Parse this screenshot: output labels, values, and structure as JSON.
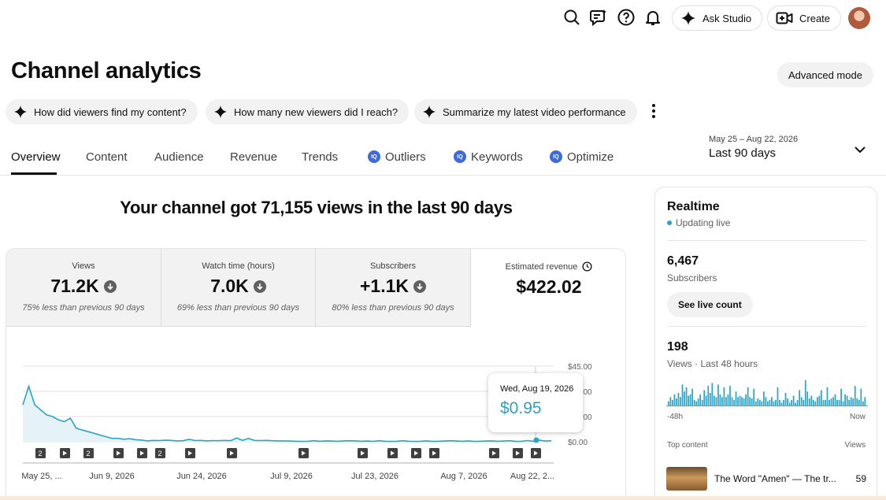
{
  "topbar": {
    "ask_studio_label": "Ask Studio",
    "create_label": "Create",
    "icons": [
      "search-icon",
      "feedback-icon",
      "help-icon",
      "notifications-icon"
    ]
  },
  "page": {
    "title": "Channel analytics",
    "advanced_mode_label": "Advanced mode"
  },
  "chips": [
    {
      "label": "How did viewers find my content?"
    },
    {
      "label": "How many new viewers did I reach?"
    },
    {
      "label": "Summarize my latest video performance"
    }
  ],
  "tabs": [
    {
      "label": "Overview",
      "active": true
    },
    {
      "label": "Content"
    },
    {
      "label": "Audience"
    },
    {
      "label": "Revenue"
    },
    {
      "label": "Trends"
    },
    {
      "label": "Outliers",
      "badge": "IQ"
    },
    {
      "label": "Keywords",
      "badge": "IQ"
    },
    {
      "label": "Optimize",
      "badge": "IQ"
    }
  ],
  "date_range": {
    "dates": "May 25 – Aug 22, 2026",
    "label": "Last 90 days"
  },
  "headline": "Your channel got 71,155 views in the last 90 days",
  "metrics": [
    {
      "label": "Views",
      "value": "71.2K",
      "note": "75% less than previous 90 days",
      "trend": "down"
    },
    {
      "label": "Watch time (hours)",
      "value": "7.0K",
      "note": "69% less than previous 90 days",
      "trend": "down"
    },
    {
      "label": "Subscribers",
      "value": "+1.1K",
      "note": "80% less than previous 90 days",
      "trend": "down"
    },
    {
      "label": "Estimated revenue",
      "value": "$422.02",
      "note": "",
      "trend": "none"
    }
  ],
  "chart_data": {
    "type": "area",
    "title": "",
    "series": [
      {
        "values": [
          22,
          33,
          22,
          19,
          16,
          15,
          13,
          12,
          14,
          8,
          7,
          6,
          5,
          4,
          3,
          2,
          2,
          1.5,
          1.8,
          1.2,
          1,
          0.5,
          0.8,
          0.7,
          0.9,
          0.8,
          0.5,
          0.6,
          1.4,
          0.7,
          0.8,
          0.5,
          0.7,
          0.6,
          0.8,
          0.6,
          2.2,
          0.8,
          1.9,
          0.8,
          0.7,
          0.8,
          0.6,
          0.5,
          0.5,
          0.4,
          0.3,
          0.2,
          0.3,
          0.6,
          0.3,
          0.5,
          0.4,
          0.3,
          0.5,
          0.6,
          0.5,
          0.3,
          0.4,
          0.2,
          0.6,
          0.3,
          0.2,
          0.3,
          0.6,
          0.3,
          0.2,
          0.3,
          0.5,
          0.2,
          0.3,
          0.4,
          0.6,
          0.4,
          0.3,
          0.5,
          0.2,
          0.3,
          0.4,
          0.5,
          0.3,
          0.4,
          0.6,
          0.2,
          0.3,
          0.7,
          0.3,
          0.9,
          0.4,
          0.6
        ]
      }
    ],
    "ylim": [
      0,
      45
    ],
    "y_ticks": [
      "$0.00",
      "$15.00",
      "$30.00",
      "$45.00"
    ],
    "x_ticks": [
      "May 25, ...",
      "Jun 9, 2026",
      "Jun 24, 2026",
      "Jul 9, 2026",
      "Jul 23, 2026",
      "Aug 7, 2026",
      "Aug 22, 2..."
    ],
    "video_markers": [
      {
        "x": 51,
        "type": "2"
      },
      {
        "x": 82,
        "type": "play"
      },
      {
        "x": 112,
        "type": "2"
      },
      {
        "x": 150,
        "type": "play"
      },
      {
        "x": 180,
        "type": "play"
      },
      {
        "x": 203,
        "type": "2"
      },
      {
        "x": 241,
        "type": "play"
      },
      {
        "x": 294,
        "type": "play"
      },
      {
        "x": 385,
        "type": "play"
      },
      {
        "x": 460,
        "type": "play"
      },
      {
        "x": 498,
        "type": "play"
      },
      {
        "x": 528,
        "type": "play"
      },
      {
        "x": 551,
        "type": "play"
      },
      {
        "x": 627,
        "type": "play"
      },
      {
        "x": 657,
        "type": "play"
      },
      {
        "x": 680,
        "type": "play"
      }
    ],
    "grid": true
  },
  "tooltip": {
    "date": "Wed, Aug 19, 2026",
    "value": "$0.95"
  },
  "realtime": {
    "title": "Realtime",
    "status": "Updating live",
    "subscribers_value": "6,467",
    "subscribers_label": "Subscribers",
    "live_count_label": "See live count",
    "views_value": "198",
    "views_label": "Views · Last 48 hours",
    "axis_start": "-48h",
    "axis_end": "Now",
    "bars": [
      3,
      6,
      4,
      8,
      5,
      9,
      6,
      15,
      10,
      13,
      7,
      8,
      12,
      4,
      3,
      5,
      8,
      4,
      11,
      7,
      14,
      9,
      16,
      7,
      6,
      15,
      8,
      6,
      13,
      6,
      8,
      14,
      6,
      4,
      10,
      6,
      7,
      6,
      5,
      8,
      13,
      6,
      5,
      12,
      3,
      5,
      4,
      3,
      10,
      6,
      3,
      4,
      6,
      3,
      4,
      13,
      4,
      2,
      4,
      9,
      5,
      2,
      4,
      7,
      2,
      4,
      11,
      6,
      4,
      18,
      10,
      5,
      7,
      4,
      3,
      6,
      7,
      11,
      4,
      4,
      13,
      4,
      5,
      6,
      8,
      4,
      4,
      12,
      3,
      8,
      7,
      4,
      6,
      5,
      14,
      5,
      4,
      12,
      3,
      6
    ]
  },
  "top_content": {
    "header_left": "Top content",
    "header_right": "Views",
    "items": [
      {
        "title": "The Word \"Amen\" — The tr...",
        "views": "59"
      }
    ]
  }
}
